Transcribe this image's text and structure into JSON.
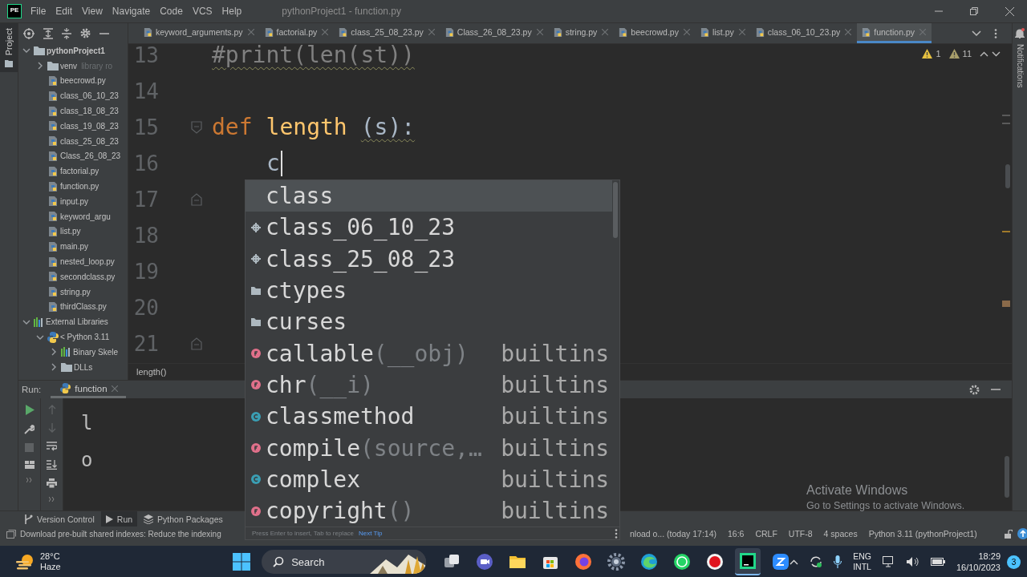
{
  "title_bar": {
    "logo": "PE",
    "menus": [
      "File",
      "Edit",
      "View",
      "Navigate",
      "Code",
      "VCS",
      "Help"
    ],
    "title": "pythonProject1 - function.py"
  },
  "side_labels": {
    "left": "Project",
    "right": "Notifications"
  },
  "editor_tabs": [
    {
      "label": "keyword_arguments.py",
      "selected": false
    },
    {
      "label": "factorial.py",
      "selected": false
    },
    {
      "label": "class_25_08_23.py",
      "selected": false
    },
    {
      "label": "Class_26_08_23.py",
      "selected": false
    },
    {
      "label": "string.py",
      "selected": false
    },
    {
      "label": "beecrowd.py",
      "selected": false
    },
    {
      "label": "list.py",
      "selected": false
    },
    {
      "label": "class_06_10_23.py",
      "selected": false
    },
    {
      "label": "function.py",
      "selected": true
    }
  ],
  "inspections": {
    "warnings": "1",
    "weak_warnings": "11"
  },
  "project_tree": [
    {
      "label": "pythonProject1",
      "kind": "folder",
      "expanded": true,
      "children": [
        {
          "label": "venv",
          "note": "library ro",
          "kind": "folder",
          "expanded": false
        },
        {
          "label": "beecrowd.py",
          "kind": "file"
        },
        {
          "label": "class_06_10_23",
          "kind": "file"
        },
        {
          "label": "class_18_08_23",
          "kind": "file"
        },
        {
          "label": "class_19_08_23",
          "kind": "file"
        },
        {
          "label": "class_25_08_23",
          "kind": "file"
        },
        {
          "label": "Class_26_08_23",
          "kind": "file"
        },
        {
          "label": "factorial.py",
          "kind": "file"
        },
        {
          "label": "function.py",
          "kind": "file"
        },
        {
          "label": "input.py",
          "kind": "file"
        },
        {
          "label": "keyword_argu",
          "kind": "file"
        },
        {
          "label": "list.py",
          "kind": "file"
        },
        {
          "label": "main.py",
          "kind": "file"
        },
        {
          "label": "nested_loop.py",
          "kind": "file"
        },
        {
          "label": "secondclass.py",
          "kind": "file"
        },
        {
          "label": "string.py",
          "kind": "file"
        },
        {
          "label": "thirdClass.py",
          "kind": "file"
        }
      ]
    },
    {
      "label": "External Libraries",
      "kind": "library",
      "expanded": true,
      "children": [
        {
          "label": "< Python 3.11",
          "kind": "python",
          "expanded": true,
          "children": [
            {
              "label": "Binary Skele",
              "kind": "library",
              "expanded": false
            },
            {
              "label": "DLLs",
              "kind": "folder",
              "expanded": false
            }
          ]
        }
      ]
    }
  ],
  "editor": {
    "lines": [
      {
        "number": "13",
        "kind": "top",
        "fold_start": false,
        "fold_end": false,
        "tokens": [
          {
            "text": "#print(len(st))",
            "kind": "comment",
            "squiggle": true
          }
        ]
      },
      {
        "number": "14",
        "kind": "blank",
        "fold_start": false,
        "fold_end": false
      },
      {
        "number": "15",
        "kind": "top",
        "fold_start": true,
        "fold_end": false,
        "tokens": [
          {
            "text": "def",
            "kind": "keyword"
          },
          {
            "text": "length",
            "kind": "function"
          },
          {
            "text": "(s):",
            "kind": "plain",
            "squiggle": true
          }
        ]
      },
      {
        "number": "16",
        "kind": "body",
        "fold_start": false,
        "fold_end": false,
        "caret": true,
        "tokens": [
          {
            "text": "c",
            "kind": "plain"
          }
        ]
      },
      {
        "number": "17",
        "kind": "blank",
        "fold_start": false,
        "fold_end": true
      },
      {
        "number": "18",
        "kind": "blank",
        "fold_start": false,
        "fold_end": false
      },
      {
        "number": "19",
        "kind": "blank",
        "fold_start": false,
        "fold_end": false
      },
      {
        "number": "20",
        "kind": "blank",
        "fold_start": false,
        "fold_end": false
      },
      {
        "number": "21",
        "kind": "blank",
        "fold_start": false,
        "fold_end": true
      }
    ],
    "breadcrumb": "length()"
  },
  "completion": {
    "items": [
      {
        "name": "class",
        "kind": "keyword",
        "selected": true
      },
      {
        "name": "class_06_10_23",
        "kind": "module",
        "selected": false
      },
      {
        "name": "class_25_08_23",
        "kind": "module",
        "selected": false
      },
      {
        "name": "ctypes",
        "kind": "package",
        "selected": false
      },
      {
        "name": "curses",
        "kind": "package",
        "selected": false
      },
      {
        "name": "callable",
        "params": "(__obj)",
        "source": "builtins",
        "kind": "function",
        "selected": false
      },
      {
        "name": "chr",
        "params": "(__i)",
        "source": "builtins",
        "kind": "function",
        "selected": false
      },
      {
        "name": "classmethod",
        "source": "builtins",
        "kind": "class",
        "selected": false
      },
      {
        "name": "compile",
        "params": "(source,…",
        "source": "builtins",
        "kind": "function",
        "selected": false
      },
      {
        "name": "complex",
        "source": "builtins",
        "kind": "class",
        "selected": false
      },
      {
        "name": "copyright",
        "params": "()",
        "source": "builtins",
        "kind": "function",
        "selected": false
      }
    ],
    "hint": "Press Enter to insert, Tab to replace",
    "tip_link": "Next Tip"
  },
  "run_panel": {
    "label": "Run:",
    "tab": "function",
    "output": [
      "l",
      "o"
    ]
  },
  "tool_windows": [
    {
      "label": "Version Control",
      "kind": "vcs",
      "selected": false
    },
    {
      "label": "Run",
      "kind": "run",
      "selected": true
    },
    {
      "label": "Python Packages",
      "kind": "packages",
      "selected": false
    }
  ],
  "status_bar": {
    "message": "Download pre-built shared indexes: Reduce the indexing",
    "progress": "nload o... (today 17:14)",
    "position": "16:6",
    "line_separator": "CRLF",
    "encoding": "UTF-8",
    "indent": "4 spaces",
    "interpreter": "Python 3.11 (pythonProject1)"
  },
  "activation_notice": {
    "title": "Activate Windows",
    "detail": "Go to Settings to activate Windows."
  },
  "taskbar": {
    "weather": {
      "temperature": "28°C",
      "condition": "Haze"
    },
    "search": "Search",
    "apps": [
      {
        "kind": "task-view",
        "selected": false
      },
      {
        "kind": "meet",
        "selected": false
      },
      {
        "kind": "folder",
        "selected": false
      },
      {
        "kind": "store",
        "selected": false
      },
      {
        "kind": "firefox",
        "selected": false
      },
      {
        "kind": "settings",
        "selected": false
      },
      {
        "kind": "edge",
        "selected": false
      },
      {
        "kind": "whatsapp",
        "selected": false
      },
      {
        "kind": "record",
        "selected": false
      },
      {
        "kind": "pycharm",
        "selected": true
      },
      {
        "kind": "zoom",
        "selected": false
      }
    ],
    "language": [
      "ENG",
      "INTL"
    ],
    "time": "18:29",
    "date": "16/10/2023",
    "notification_count": "3"
  }
}
